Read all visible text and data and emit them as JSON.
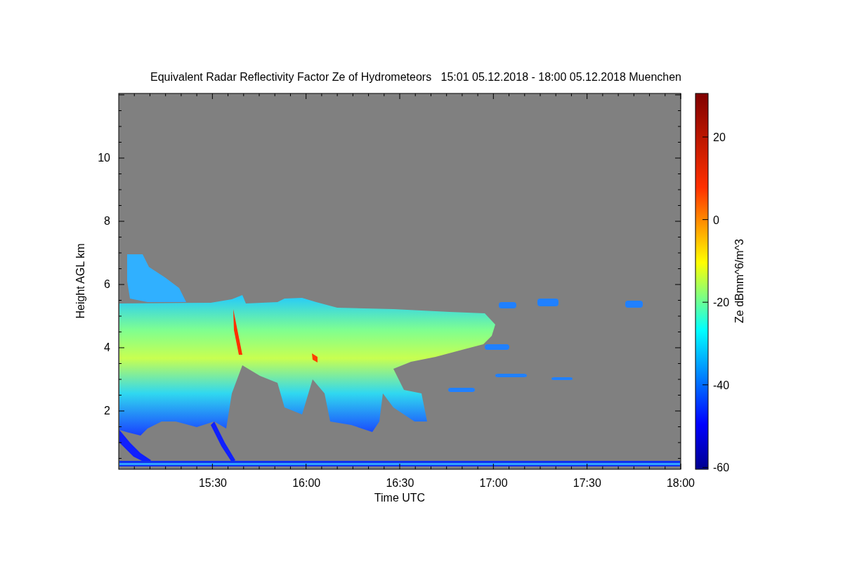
{
  "title": "Equivalent Radar Reflectivity Factor Ze of Hydrometeors   15:01 05.12.2018 - 18:00 05.12.2018 Muenchen",
  "plot": {
    "xlabel": "Time UTC",
    "ylabel": "Height AGL km",
    "xticks": [
      "15:30",
      "16:00",
      "16:30",
      "17:00",
      "17:30",
      "18:00"
    ],
    "yticks": [
      "10",
      "8",
      "6",
      "4",
      "2"
    ]
  },
  "colorbar": {
    "label": "Ze dBmm^6/m^3",
    "ticks": [
      "20",
      "0",
      "-20",
      "-40",
      "-60"
    ]
  }
}
